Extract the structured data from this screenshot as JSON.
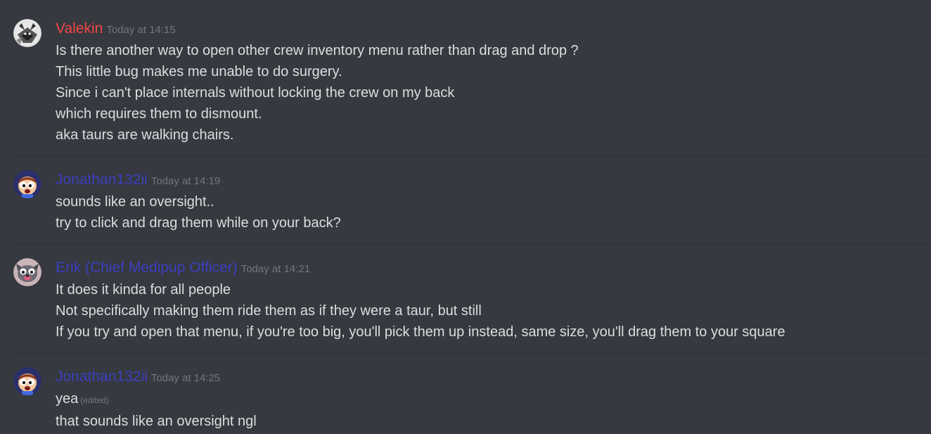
{
  "messages": [
    {
      "username": "Valekin",
      "color": "#f04747",
      "timestamp": "Today at 14:15",
      "avatar": "wolf-avatar-icon",
      "lines": [
        "Is there another way to open other crew inventory menu rather than drag and drop ?",
        "This little bug makes me unable to do surgery.",
        "Since i can't place internals without locking the crew on my back",
        "which requires them to dismount.",
        "aka taurs are walking chairs."
      ]
    },
    {
      "username": "Jonathan132ii",
      "color": "#3b3fbd",
      "timestamp": "Today at 14:19",
      "avatar": "cartoon-face-avatar-icon",
      "lines": [
        "sounds like an oversight..",
        "try to click and drag them while on your back?"
      ]
    },
    {
      "username": "Erik (Chief Medipup Officer)",
      "color": "#3b3fbd",
      "timestamp": "Today at 14:21",
      "avatar": "dog-avatar-icon",
      "lines": [
        "It does it kinda for all people",
        "Not specifically making them ride them as if they were a taur, but still",
        "If you try and open that menu, if you're too big, you'll pick them up instead, same size, you'll drag them to your square"
      ]
    },
    {
      "username": "Jonathan132ii",
      "color": "#3b3fbd",
      "timestamp": "Today at 14:25",
      "avatar": "cartoon-face-avatar-icon",
      "lines": [
        "yea",
        "that sounds like an oversight ngl"
      ],
      "edited_label": "(edited)"
    }
  ]
}
